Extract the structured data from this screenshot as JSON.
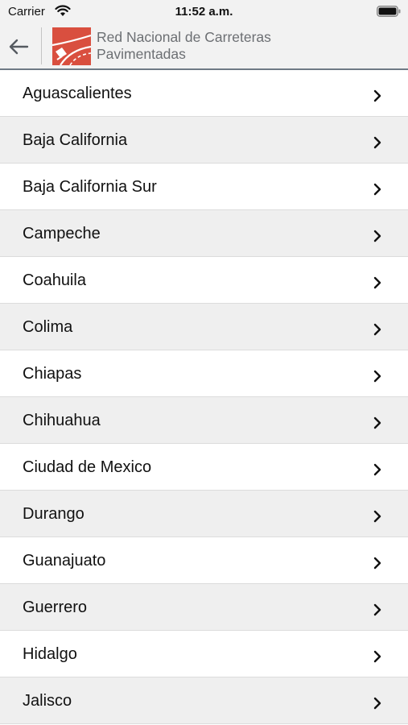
{
  "status_bar": {
    "carrier": "Carrier",
    "time": "11:52 a.m."
  },
  "header": {
    "back_icon": "arrow-left-icon",
    "logo_icon": "road-logo-icon",
    "title": "Red Nacional de Carreteras Pavimentadas"
  },
  "colors": {
    "logo_red": "#d94f3f",
    "header_bg": "#f2f2f2",
    "row_shade": "#efefef",
    "title_gray": "#6c6f73"
  },
  "states": [
    {
      "label": "Aguascalientes"
    },
    {
      "label": "Baja California"
    },
    {
      "label": "Baja California Sur"
    },
    {
      "label": "Campeche"
    },
    {
      "label": "Coahuila"
    },
    {
      "label": "Colima"
    },
    {
      "label": "Chiapas"
    },
    {
      "label": "Chihuahua"
    },
    {
      "label": "Ciudad de Mexico"
    },
    {
      "label": "Durango"
    },
    {
      "label": "Guanajuato"
    },
    {
      "label": "Guerrero"
    },
    {
      "label": "Hidalgo"
    },
    {
      "label": "Jalisco"
    }
  ]
}
